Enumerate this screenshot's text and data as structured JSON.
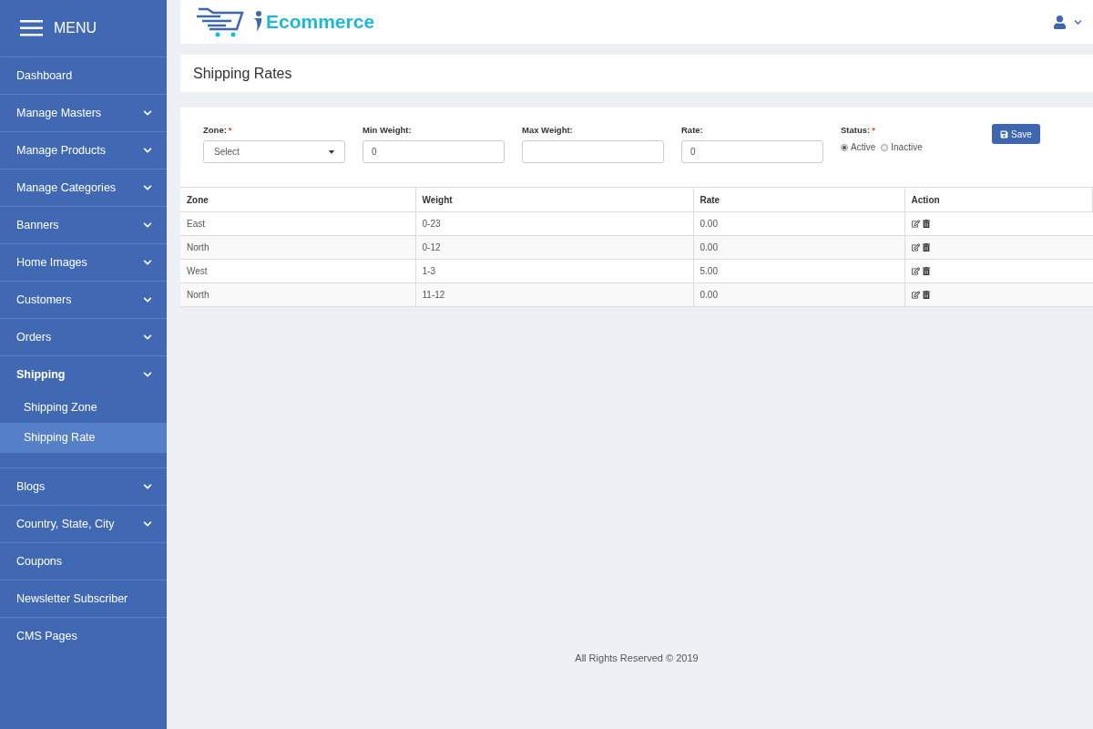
{
  "sidebar": {
    "menu_label": "MENU",
    "items": [
      {
        "label": "Dashboard",
        "expandable": false
      },
      {
        "label": "Manage Masters",
        "expandable": true,
        "expanded": false
      },
      {
        "label": "Manage Products",
        "expandable": true,
        "expanded": false
      },
      {
        "label": "Manage Categories",
        "expandable": true,
        "expanded": false
      },
      {
        "label": "Banners",
        "expandable": true,
        "expanded": false
      },
      {
        "label": "Home Images",
        "expandable": true,
        "expanded": false
      },
      {
        "label": "Customers",
        "expandable": true,
        "expanded": false
      },
      {
        "label": "Orders",
        "expandable": true,
        "expanded": false
      },
      {
        "label": "Shipping",
        "expandable": true,
        "expanded": true,
        "children": [
          {
            "label": "Shipping Zone",
            "selected": false
          },
          {
            "label": "Shipping Rate",
            "selected": true
          }
        ]
      },
      {
        "label": "Blogs",
        "expandable": true,
        "expanded": false
      },
      {
        "label": "Country, State, City",
        "expandable": true,
        "expanded": false
      },
      {
        "label": "Coupons",
        "expandable": false
      },
      {
        "label": "Newsletter Subscriber",
        "expandable": false
      },
      {
        "label": "CMS Pages",
        "expandable": false
      }
    ]
  },
  "header": {
    "logo_text": "Ecommerce"
  },
  "page_title": "Shipping Rates",
  "form": {
    "fields": [
      {
        "kind": "select",
        "label": "Zone:",
        "required_mark": "*",
        "value": "Select"
      },
      {
        "kind": "input",
        "label": "Min Weight:",
        "value": "0"
      },
      {
        "kind": "input",
        "label": "Max Weight:"
      },
      {
        "kind": "input",
        "label": "Rate:",
        "value": "0"
      }
    ],
    "status": {
      "label": "Status:",
      "required_mark": "*",
      "options": [
        {
          "label": "Active",
          "selected": true
        },
        {
          "label": "Inactive",
          "selected": false
        }
      ]
    },
    "save_button": "Save"
  },
  "table": {
    "columns": [
      "Zone",
      "Weight",
      "Rate",
      "Action"
    ],
    "rows": [
      [
        "East",
        "0-23",
        "0.00"
      ],
      [
        "North",
        "0-12",
        "0.00"
      ],
      [
        "West",
        "1-3",
        "5.00"
      ],
      [
        "North",
        "11-12",
        "0.00"
      ]
    ]
  },
  "footer": "All Rights Reserved © 2019"
}
